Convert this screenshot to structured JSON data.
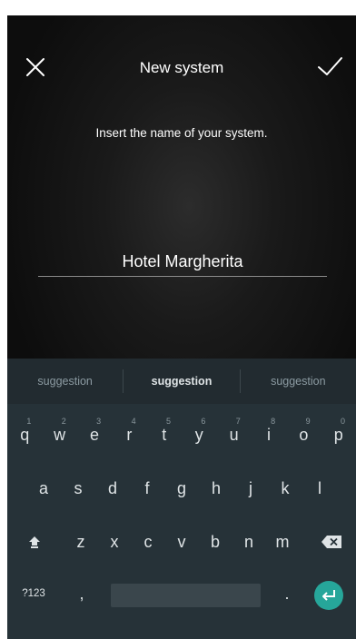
{
  "header": {
    "title": "New system",
    "close_icon": "close-icon",
    "confirm_icon": "checkmark-icon"
  },
  "prompt": "Insert the name of your system.",
  "name_field": {
    "value": "Hotel Margherita"
  },
  "keyboard": {
    "suggestions": [
      "suggestion",
      "suggestion",
      "suggestion"
    ],
    "row1": [
      {
        "key": "q",
        "hint": "1"
      },
      {
        "key": "w",
        "hint": "2"
      },
      {
        "key": "e",
        "hint": "3"
      },
      {
        "key": "r",
        "hint": "4"
      },
      {
        "key": "t",
        "hint": "5"
      },
      {
        "key": "y",
        "hint": "6"
      },
      {
        "key": "u",
        "hint": "7"
      },
      {
        "key": "i",
        "hint": "8"
      },
      {
        "key": "o",
        "hint": "9"
      },
      {
        "key": "p",
        "hint": "0"
      }
    ],
    "row2": [
      "a",
      "s",
      "d",
      "f",
      "g",
      "h",
      "j",
      "k",
      "l"
    ],
    "row3": [
      "z",
      "x",
      "c",
      "v",
      "b",
      "n",
      "m"
    ],
    "symbols_key": "?123",
    "comma_key": ",",
    "period_key": ".",
    "colors": {
      "background": "#263238",
      "suggestion_bar": "#222b30",
      "enter_key": "#26a69a"
    }
  }
}
